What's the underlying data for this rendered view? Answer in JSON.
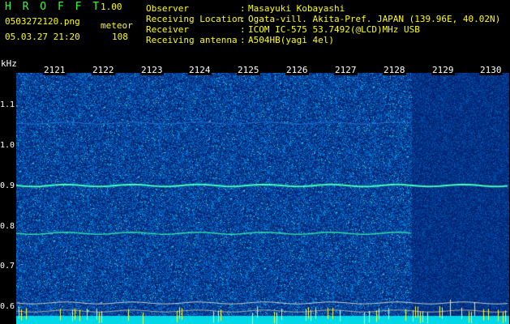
{
  "header": {
    "app_title": "H R O F F T",
    "version": "1.00",
    "filename": "0503272120.png",
    "mode": "meteor",
    "timestamp": "05.03.27 21:20",
    "count": "108"
  },
  "info": [
    {
      "key": "Observer",
      "sep": ":",
      "value": "Masayuki Kobayashi"
    },
    {
      "key": "Receiving Location",
      "sep": ":",
      "value": "Ogata-vill. Akita-Pref. JAPAN (139.96E, 40.02N)"
    },
    {
      "key": "Receiver",
      "sep": ":",
      "value": "ICOM IC-575 53.7492(@LCD)MHz USB"
    },
    {
      "key": "Receiving antenna",
      "sep": ":",
      "value": "A504HB(yagi 4el)"
    }
  ],
  "axis": {
    "unit": "kHz",
    "y_labels": [
      "1.1",
      "1.0",
      "0.9",
      "0.8",
      "0.7",
      "0.6"
    ],
    "time_labels": [
      "2121",
      "2122",
      "2123",
      "2124",
      "2125",
      "2126",
      "2127",
      "2128",
      "2129",
      "2130"
    ]
  },
  "colors": {
    "background": "#001a8c",
    "trace": "#33ff99",
    "header_text": "#ffff00",
    "title_text": "#33ff33"
  }
}
